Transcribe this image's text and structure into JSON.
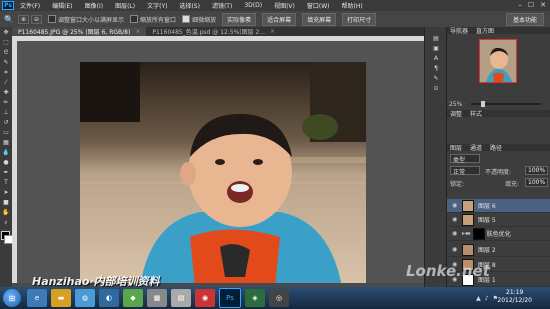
{
  "app": {
    "logo": "Ps"
  },
  "menu": [
    "文件(F)",
    "编辑(E)",
    "图像(I)",
    "图层(L)",
    "文字(Y)",
    "选择(S)",
    "滤镜(T)",
    "3D(D)",
    "视图(V)",
    "窗口(W)",
    "帮助(H)"
  ],
  "window_controls": [
    "–",
    "☐",
    "✕"
  ],
  "options": {
    "resize_windows": "调整窗口大小以满屏显示",
    "zoom_all": "缩放所有窗口",
    "scrubby_zoom": "细微缩放",
    "actual_pixels": "实际像素",
    "fit_screen": "适合屏幕",
    "fill_screen": "填充屏幕",
    "print_size": "打印尺寸",
    "workspace": "基本功能"
  },
  "tabs": [
    {
      "label": "P1160485.JPG @ 25% (图层 6, RGB/8)",
      "active": true
    },
    {
      "label": "P1160485_色温.psd @ 12.5%(图层 2...",
      "active": false
    }
  ],
  "tools": [
    "move",
    "marquee",
    "lasso",
    "quick-select",
    "crop",
    "eyedropper",
    "healing",
    "brush",
    "clone",
    "history",
    "eraser",
    "gradient",
    "blur",
    "dodge",
    "pen",
    "type",
    "path-select",
    "shape",
    "hand",
    "zoom"
  ],
  "navigator": {
    "tabs": [
      "导航器",
      "直方图"
    ],
    "zoom": "25%"
  },
  "adjust_panel": {
    "tabs": [
      "调整",
      "样式"
    ]
  },
  "layers_panel": {
    "tabs": [
      "图层",
      "通道",
      "路径"
    ],
    "kind": "类型",
    "blend_mode": "正常",
    "opacity_label": "不透明度:",
    "opacity": "100%",
    "lock_label": "锁定:",
    "fill_label": "填充:",
    "fill": "100%",
    "layers": [
      {
        "name": "图层 6",
        "selected": true
      },
      {
        "name": "图层 5",
        "selected": false
      },
      {
        "name": "肤色优化",
        "selected": false
      },
      {
        "name": "图层 2",
        "selected": false
      },
      {
        "name": "图层 8",
        "selected": false
      },
      {
        "name": "图层 1",
        "selected": false
      }
    ]
  },
  "watermarks": {
    "left": "Hanzihao·内部培训资料",
    "right": "Lonke.net"
  },
  "clock": {
    "time": "21:19",
    "date": "2012/12/20"
  },
  "colors": {
    "layer_selected": "#4d6182",
    "menubar": "#3a3a3a",
    "panel": "#3d3d3d"
  }
}
